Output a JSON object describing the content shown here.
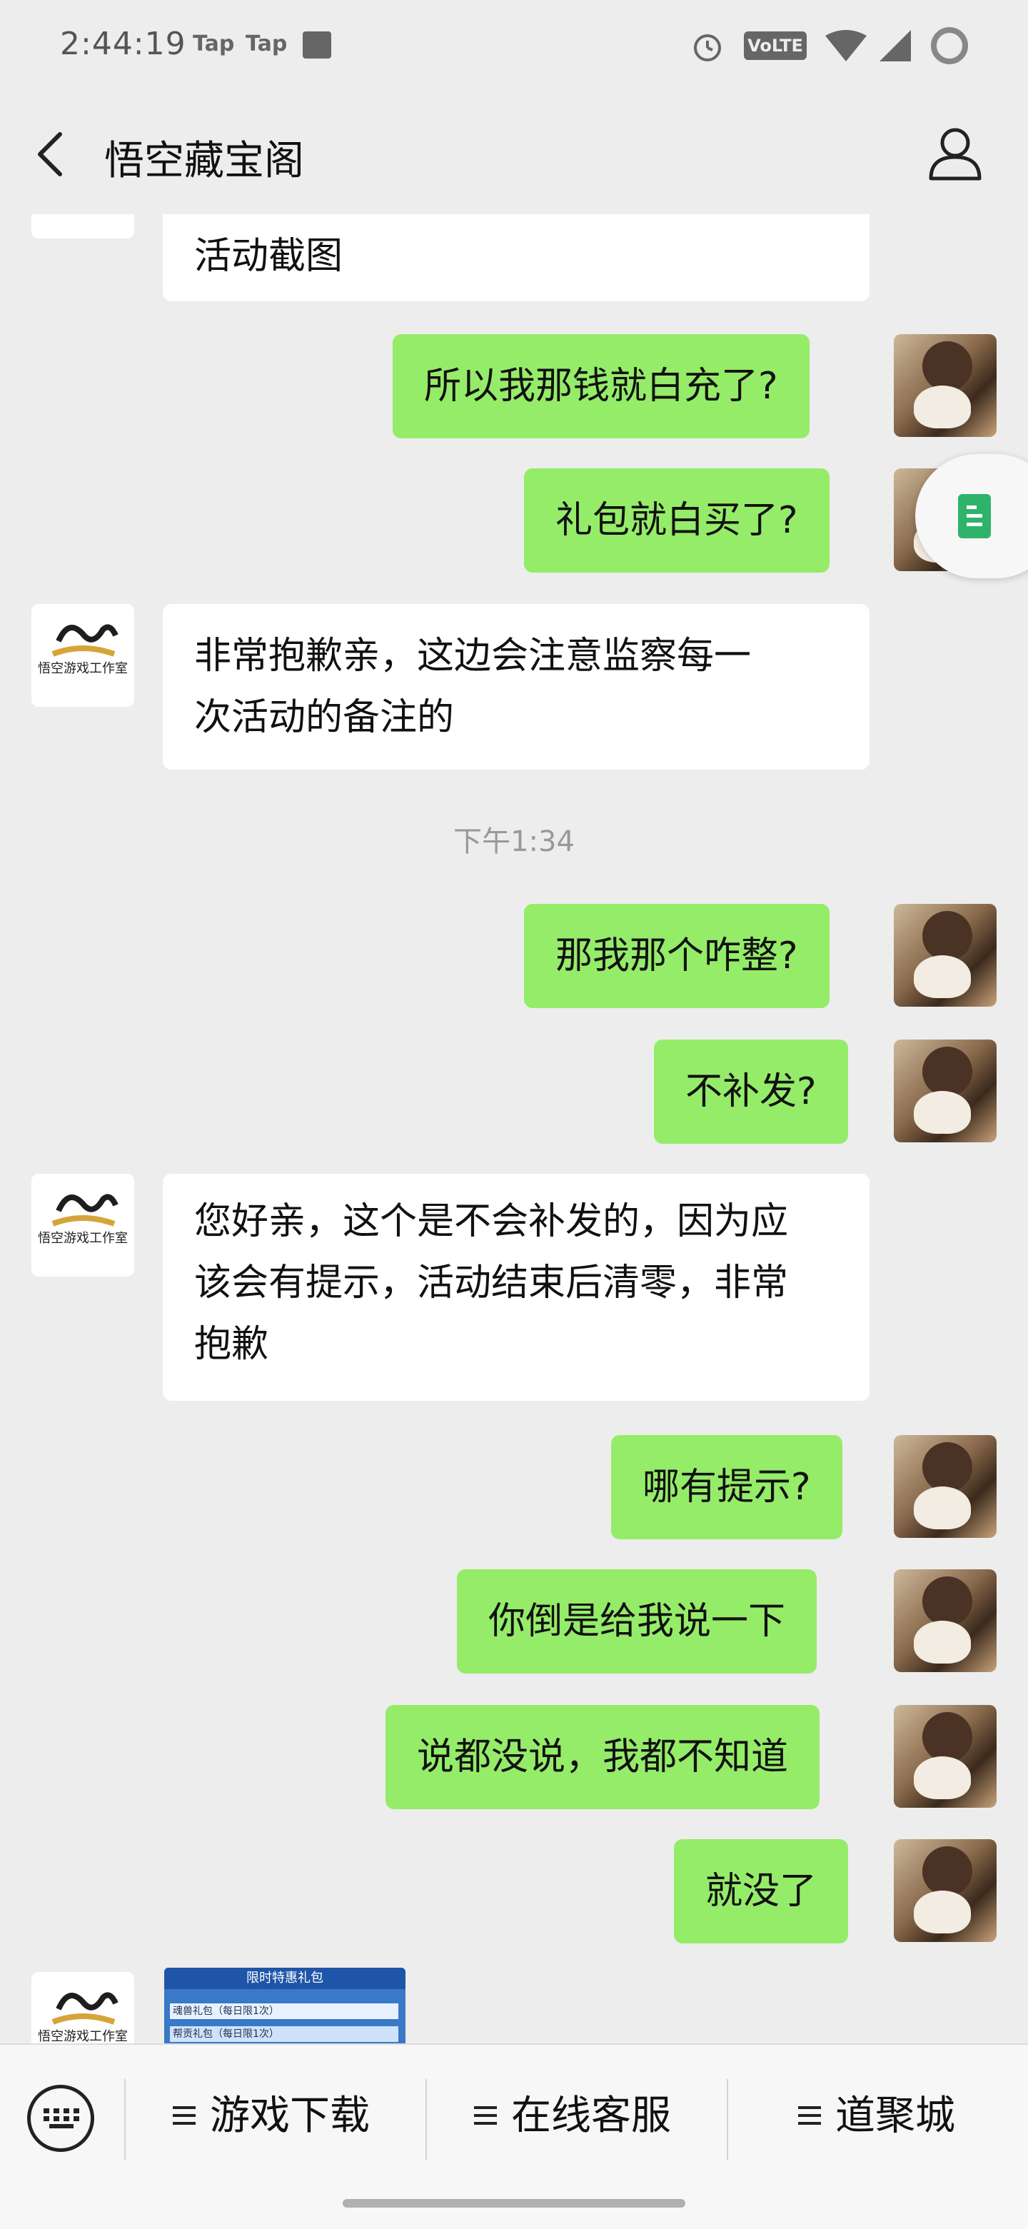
{
  "status_bar": {
    "time": "2:44:19",
    "notif1": "Tap",
    "notif2": "Tap",
    "network": "VoLTE"
  },
  "header": {
    "title": "悟空藏宝阁",
    "back_icon": "chevron-left-icon",
    "profile_icon": "person-icon"
  },
  "messages": [
    {
      "from": "bot",
      "text": "活动截图"
    },
    {
      "from": "user",
      "text": "所以我那钱就白充了?"
    },
    {
      "from": "user",
      "text": "礼包就白买了?"
    },
    {
      "from": "bot",
      "text": "非常抱歉亲，这边会注意监察每一\n次活动的备注的"
    },
    {
      "from": "user",
      "text": "那我那个咋整?"
    },
    {
      "from": "user",
      "text": "不补发?"
    },
    {
      "from": "bot",
      "text": "您好亲，这个是不会补发的，因为应\n该会有提示，活动结束后清零，非常\n抱歉"
    },
    {
      "from": "user",
      "text": "哪有提示?"
    },
    {
      "from": "user",
      "text": "你倒是给我说一下"
    },
    {
      "from": "user",
      "text": "说都没说，我都不知道"
    },
    {
      "from": "user",
      "text": "就没了"
    }
  ],
  "timestamp": "下午1:34",
  "bot_avatar_label": "悟空游戏工作室",
  "image_preview": {
    "title": "限时特惠礼包",
    "row1": "魂兽礼包（每日限1次）",
    "row2": "帮贡礼包（每日限1次）"
  },
  "bottom_menu": {
    "items": [
      "游戏下载",
      "在线客服",
      "道聚城"
    ]
  },
  "colors": {
    "background": "#ededed",
    "outgoing_bubble": "#95ec69",
    "incoming_bubble": "#ffffff"
  }
}
